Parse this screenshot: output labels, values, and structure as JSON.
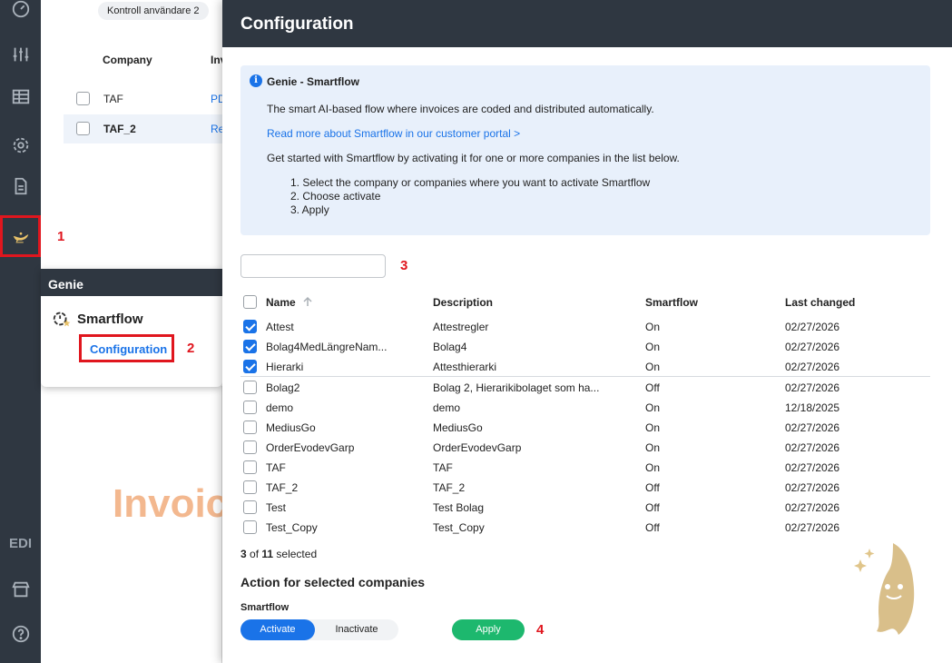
{
  "sidenav": {
    "icons": [
      "dashboard-icon",
      "sliders-icon",
      "table-icon",
      "gear-icon",
      "document-icon",
      "genie-lamp-icon",
      "store-icon",
      "help-icon"
    ],
    "edi_label": "EDI"
  },
  "background": {
    "tab_label": "Kontroll användare 2",
    "columns": [
      "Company",
      "Inv"
    ],
    "rows": [
      {
        "company": "TAF",
        "inv": "PD"
      },
      {
        "company": "TAF_2",
        "inv": "Re"
      }
    ],
    "invoice_text": "Invoic"
  },
  "genie_menu": {
    "title": "Genie",
    "item": "Smartflow",
    "subitem": "Configuration"
  },
  "annotations": [
    "1",
    "2",
    "3",
    "4"
  ],
  "modal": {
    "title": "Configuration",
    "info": {
      "title": "Genie - Smartflow",
      "description": "The smart AI-based flow where invoices are coded and distributed automatically.",
      "link": "Read more about Smartflow in our customer portal >",
      "intro": "Get started with Smartflow by activating it for one or more companies in the list below.",
      "steps": [
        "1. Select the company or companies where you want to activate Smartflow",
        "2. Choose activate",
        "3. Apply"
      ]
    },
    "search_value": "",
    "columns": {
      "name": "Name",
      "description": "Description",
      "smartflow": "Smartflow",
      "last_changed": "Last changed"
    },
    "rows": [
      {
        "checked": true,
        "name": "Attest",
        "description": "Attestregler",
        "smartflow": "On",
        "last_changed": "02/27/2026"
      },
      {
        "checked": true,
        "name": "Bolag4MedLängreNam...",
        "description": "Bolag4",
        "smartflow": "On",
        "last_changed": "02/27/2026"
      },
      {
        "checked": true,
        "name": "Hierarki",
        "description": "Attesthierarki",
        "smartflow": "On",
        "last_changed": "02/27/2026"
      },
      {
        "checked": false,
        "name": "Bolag2",
        "description": "Bolag 2, Hierarikibolaget som ha...",
        "smartflow": "Off",
        "last_changed": "02/27/2026"
      },
      {
        "checked": false,
        "name": "demo",
        "description": "demo",
        "smartflow": "On",
        "last_changed": "12/18/2025"
      },
      {
        "checked": false,
        "name": "MediusGo",
        "description": "MediusGo",
        "smartflow": "On",
        "last_changed": "02/27/2026"
      },
      {
        "checked": false,
        "name": "OrderEvodevGarp",
        "description": "OrderEvodevGarp",
        "smartflow": "On",
        "last_changed": "02/27/2026"
      },
      {
        "checked": false,
        "name": "TAF",
        "description": "TAF",
        "smartflow": "On",
        "last_changed": "02/27/2026"
      },
      {
        "checked": false,
        "name": "TAF_2",
        "description": "TAF_2",
        "smartflow": "Off",
        "last_changed": "02/27/2026"
      },
      {
        "checked": false,
        "name": "Test",
        "description": "Test Bolag",
        "smartflow": "Off",
        "last_changed": "02/27/2026"
      },
      {
        "checked": false,
        "name": "Test_Copy",
        "description": "Test_Copy",
        "smartflow": "Off",
        "last_changed": "02/27/2026"
      }
    ],
    "selection": {
      "selected": "3",
      "of_label": "of",
      "total": "11",
      "suffix": "selected"
    },
    "action_title": "Action for selected companies",
    "smartflow_label": "Smartflow",
    "activate_label": "Activate",
    "inactivate_label": "Inactivate",
    "apply_label": "Apply"
  },
  "colors": {
    "nav_bg": "#2f3741",
    "accent": "#1a73e8",
    "apply": "#1db86e",
    "annotation": "#e0161e",
    "info_bg": "#e8f0fb"
  }
}
